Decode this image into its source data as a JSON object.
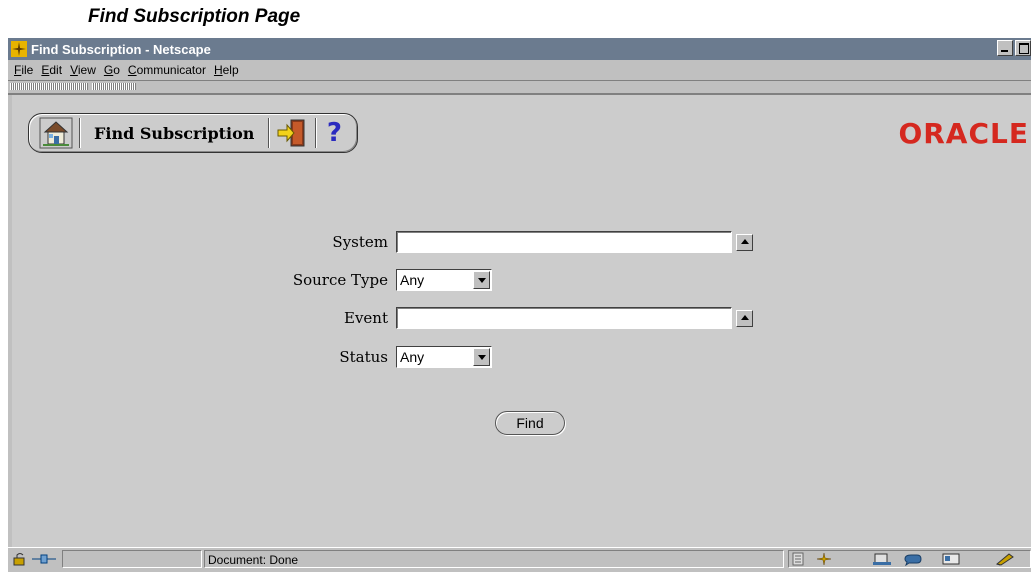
{
  "caption": "Find Subscription Page",
  "window": {
    "title": "Find Subscription - Netscape"
  },
  "menu": [
    "File",
    "Edit",
    "View",
    "Go",
    "Communicator",
    "Help"
  ],
  "header": {
    "title": "Find Subscription",
    "help_symbol": "?",
    "logo_text": "ORACLE"
  },
  "form": {
    "system": {
      "label": "System",
      "value": ""
    },
    "source_type": {
      "label": "Source Type",
      "value": "Any"
    },
    "event": {
      "label": "Event",
      "value": ""
    },
    "status": {
      "label": "Status",
      "value": "Any"
    },
    "find_label": "Find"
  },
  "statusbar": {
    "text": "Document: Done"
  },
  "colors": {
    "titlebar": "#6b7b8f",
    "content_bg": "#cccccc",
    "oracle_red": "#d5281f"
  }
}
